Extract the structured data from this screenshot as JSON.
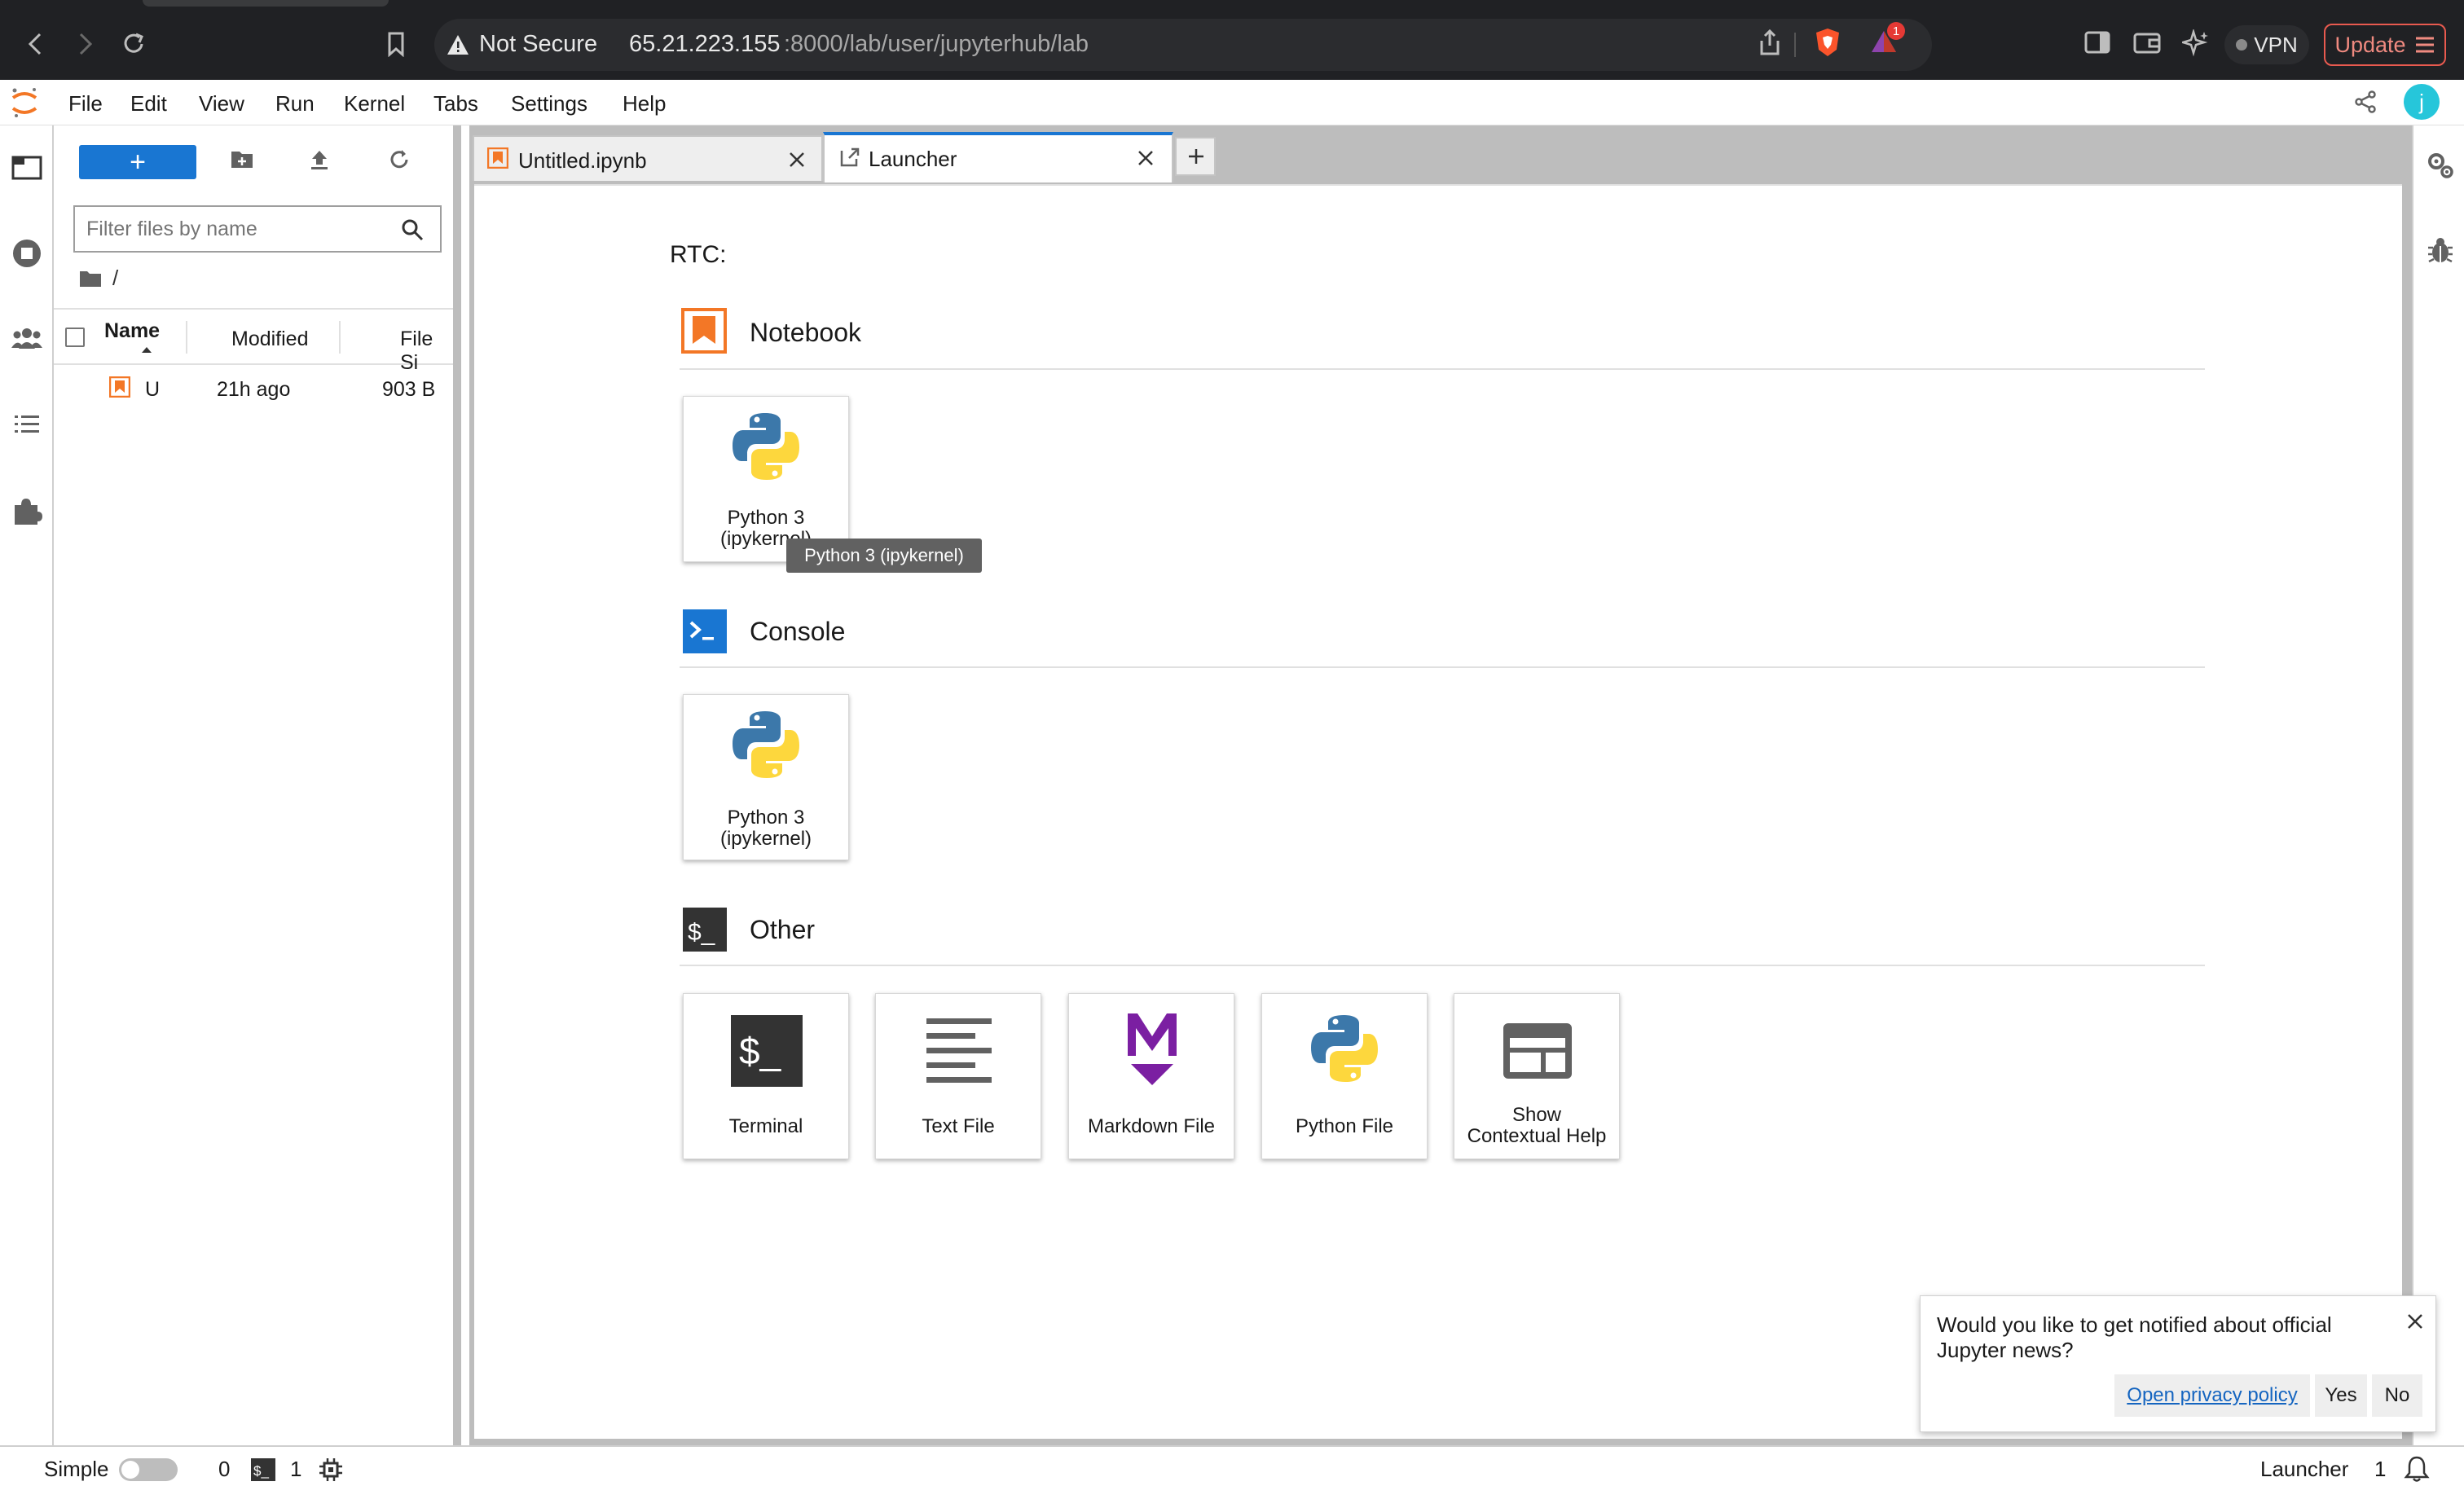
{
  "browser": {
    "security_label": "Not Secure",
    "url_host": "65.21.223.155",
    "url_rest": ":8000/lab/user/jupyterhub/lab",
    "notification_count": "1",
    "vpn_label": "VPN",
    "update_label": "Update"
  },
  "menubar": {
    "items": [
      "File",
      "Edit",
      "View",
      "Run",
      "Kernel",
      "Tabs",
      "Settings",
      "Help"
    ],
    "user_initial": "j"
  },
  "file_browser": {
    "new_button_label": "+",
    "filter_placeholder": "Filter files by name",
    "breadcrumb": "/",
    "columns": {
      "name": "Name",
      "modified": "Modified",
      "size": "File Si"
    },
    "files": [
      {
        "name": "U",
        "modified": "21h ago",
        "size": "903 B"
      }
    ]
  },
  "tabs": [
    {
      "label": "Untitled.ipynb",
      "active": false
    },
    {
      "label": "Launcher",
      "active": true
    }
  ],
  "launcher": {
    "rtc_label": "RTC:",
    "sections": {
      "notebook": {
        "title": "Notebook",
        "cards": [
          {
            "label_line1": "Python 3",
            "label_line2": "(ipykernel)",
            "icon": "python-icon"
          }
        ]
      },
      "console": {
        "title": "Console",
        "cards": [
          {
            "label_line1": "Python 3",
            "label_line2": "(ipykernel)",
            "icon": "python-icon"
          }
        ]
      },
      "other": {
        "title": "Other",
        "cards": [
          {
            "label_line1": "Terminal",
            "label_line2": "",
            "icon": "terminal-icon"
          },
          {
            "label_line1": "Text File",
            "label_line2": "",
            "icon": "text-file-icon"
          },
          {
            "label_line1": "Markdown File",
            "label_line2": "",
            "icon": "markdown-icon"
          },
          {
            "label_line1": "Python File",
            "label_line2": "",
            "icon": "python-icon"
          },
          {
            "label_line1": "Show",
            "label_line2": "Contextual Help",
            "icon": "contextual-help-icon"
          }
        ]
      }
    },
    "tooltip": "Python 3 (ipykernel)"
  },
  "notification": {
    "message": "Would you like to get notified about official Jupyter news?",
    "privacy_link": "Open privacy policy",
    "yes_label": "Yes",
    "no_label": "No"
  },
  "statusbar": {
    "mode_label": "Simple",
    "kernels_count": "0",
    "terminals_count": "1",
    "current_tab": "Launcher",
    "notifications_count": "1"
  },
  "colors": {
    "accent": "#1976d2",
    "jupyter_orange": "#f37726",
    "update_red": "#e85a4f"
  }
}
